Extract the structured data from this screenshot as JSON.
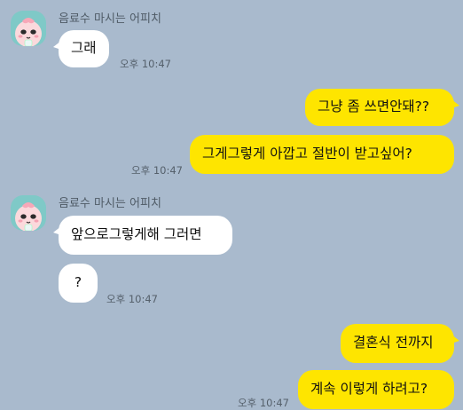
{
  "chat": {
    "contact_name": "음료수 마시는 어피치",
    "avatar_icon": "apeach-character-icon",
    "messages": [
      {
        "direction": "in",
        "text": "그래",
        "time": "오후 10:47"
      },
      {
        "direction": "out",
        "text": "그냥 좀 쓰면안돼??"
      },
      {
        "direction": "out",
        "text": "그게그렇게 아깝고 절반이 받고싶어?",
        "time": "오후 10:47"
      },
      {
        "direction": "in",
        "text": "앞으로그렇게해 그러면"
      },
      {
        "direction": "in",
        "text": "?",
        "time": "오후 10:47"
      },
      {
        "direction": "out",
        "text": "결혼식 전까지"
      },
      {
        "direction": "out",
        "text": "계속 이렇게 하려고?",
        "time": "오후 10:47"
      }
    ]
  },
  "colors": {
    "background": "#a9bacd",
    "incoming_bubble": "#ffffff",
    "outgoing_bubble": "#fee500"
  }
}
